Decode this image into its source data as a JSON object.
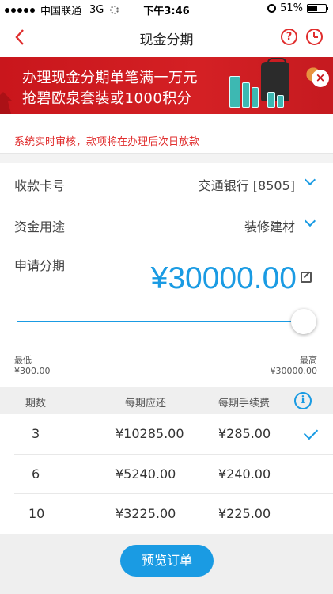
{
  "status": {
    "carrier": "中国联通",
    "network": "3G",
    "time": "下午3:46",
    "battery": "51%",
    "battery_level": 0.51
  },
  "nav": {
    "title": "现金分期",
    "help": "?"
  },
  "banner": {
    "line1": "办理现金分期单笔满一万元",
    "line2": "抢碧欧泉套装或1000积分",
    "close": "×"
  },
  "notice": "系统实时审核，款项将在办理后次日放款",
  "form": {
    "card_label": "收款卡号",
    "card_value": "交通银行 [8505]",
    "purpose_label": "资金用途",
    "purpose_value": "装修建材",
    "amount_label": "申请分期",
    "amount_value": "¥30000.00",
    "slider_level": 1.0,
    "min_label": "最低",
    "min_value": "¥300.00",
    "max_label": "最高",
    "max_value": "¥30000.00"
  },
  "table": {
    "headers": [
      "期数",
      "每期应还",
      "每期手续费"
    ],
    "info": "i",
    "rows": [
      {
        "periods": "3",
        "payment": "¥10285.00",
        "fee": "¥285.00",
        "selected": true
      },
      {
        "periods": "6",
        "payment": "¥5240.00",
        "fee": "¥240.00",
        "selected": false
      },
      {
        "periods": "10",
        "payment": "¥3225.00",
        "fee": "¥225.00",
        "selected": false
      }
    ]
  },
  "footer": {
    "button": "预览订单"
  },
  "colors": {
    "accent_blue": "#1a9be3",
    "accent_red": "#e02d2d",
    "banner_red": "#c9161c"
  }
}
